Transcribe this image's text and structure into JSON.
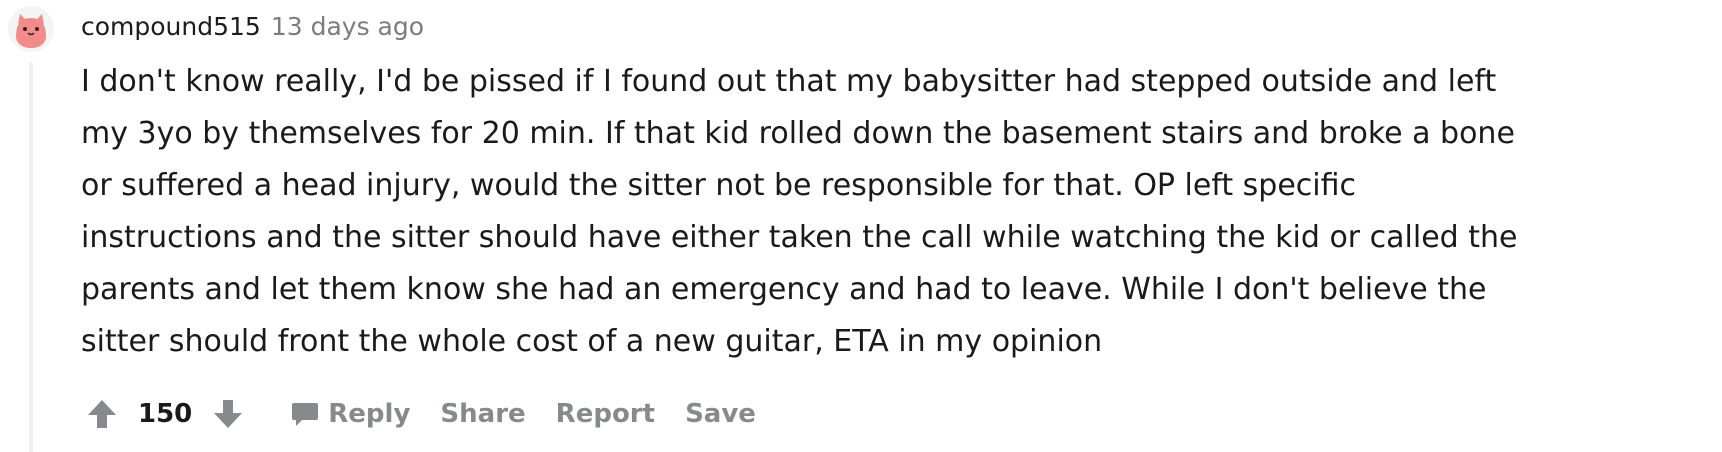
{
  "comment": {
    "author": "compound515",
    "timestamp": "13 days ago",
    "body_lines": [
      "I don't know really, I'd be pissed if I found out that my babysitter had stepped outside and left",
      "my 3yo by themselves for 20 min. If that kid rolled down the basement stairs and broke a bone",
      "or suffered a head injury, would the sitter not be responsible for that. OP left specific",
      "instructions and the sitter should have either taken the call while watching the kid or called the",
      "parents and let them know she had an emergency and had to leave. While I don't believe the",
      "sitter should front the whole cost of a new guitar, ETA in my opinion"
    ],
    "score": "150",
    "actions": {
      "reply": "Reply",
      "share": "Share",
      "report": "Report",
      "save": "Save"
    }
  },
  "icons": {
    "avatar": "snoo-avatar",
    "upvote": "arrow-up-icon",
    "downvote": "arrow-down-icon",
    "reply": "speech-bubble-icon"
  },
  "colors": {
    "avatar_face": "#f28b8b",
    "action_gray": "#878a8c",
    "thread_line": "#edeff1",
    "timestamp_gray": "#7c7c7c"
  }
}
